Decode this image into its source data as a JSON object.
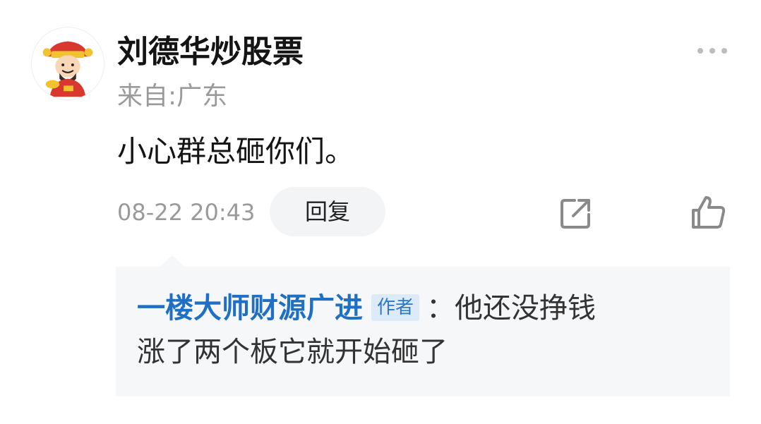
{
  "comment": {
    "author": "刘德华炒股票",
    "location": "来自:广东",
    "text": "小心群总砸你们。",
    "timestamp": "08-22 20:43",
    "reply_label": "回复",
    "icons": {
      "avatar": "cartoon-god-of-wealth-avatar",
      "more": "more-dots-icon",
      "share": "share-icon",
      "like": "thumbs-up-icon"
    }
  },
  "reply": {
    "author": "一楼大师财源广进",
    "badge": "作者",
    "separator": "：",
    "line1": "他还没挣钱",
    "line2": "涨了两个板它就开始砸了"
  },
  "colors": {
    "author_link": "#1f6fc5",
    "badge_bg": "#ddeaf8",
    "reply_bg": "#f6f7f9",
    "muted_text": "#9a9a9a"
  }
}
